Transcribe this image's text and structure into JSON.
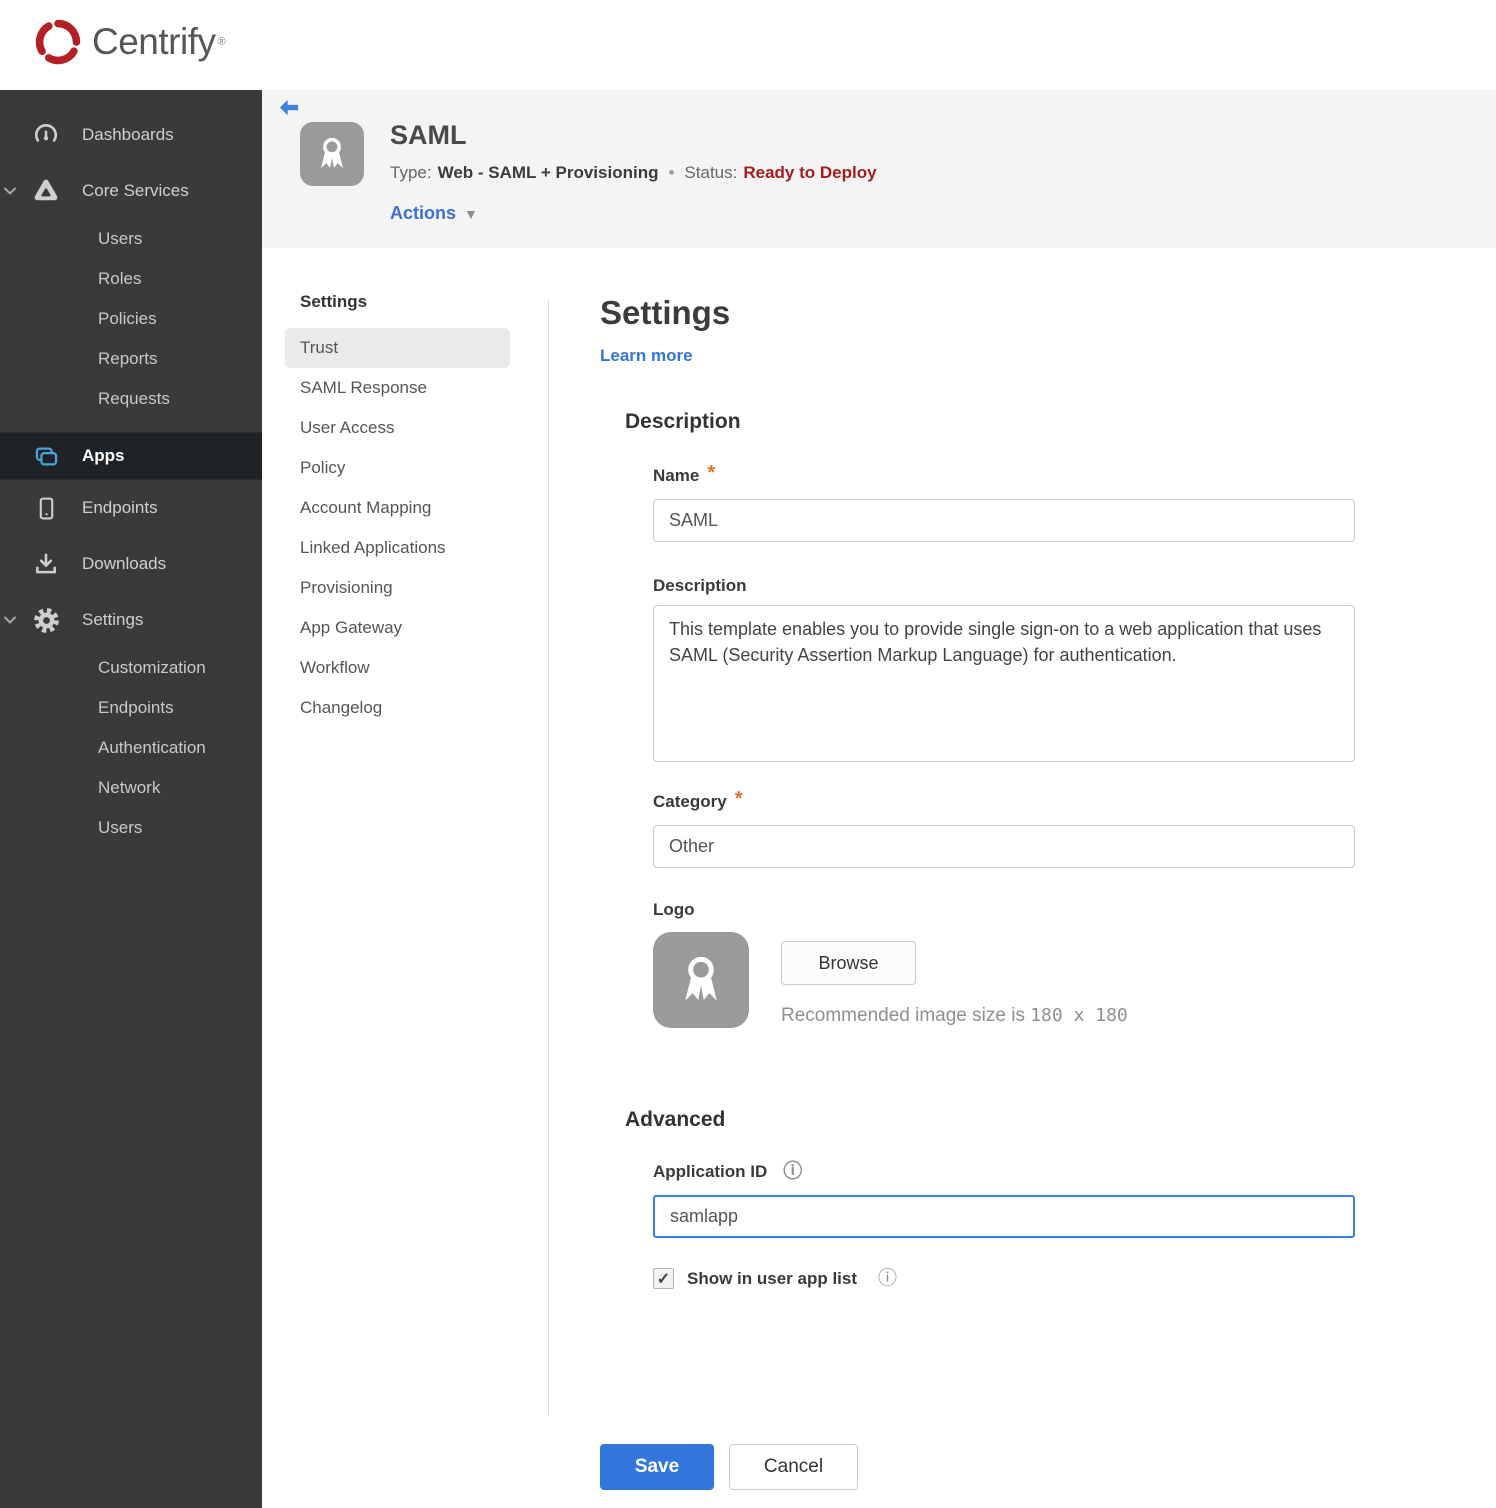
{
  "brand": {
    "name": "Centrify",
    "trademark": "®"
  },
  "colors": {
    "sidebar_bg": "#3a3a3a",
    "sidebar_selected_bg": "#1f2326",
    "accent_blue": "#3377dd",
    "apps_icon_blue": "#4aa3df",
    "status_red": "#a41e1e",
    "required_orange": "#e8702a",
    "header_bg": "#f4f4f5",
    "logo_red": "#b32025"
  },
  "sidebar": {
    "dashboards": "Dashboards",
    "core_services": "Core Services",
    "core_sub": [
      "Users",
      "Roles",
      "Policies",
      "Reports",
      "Requests"
    ],
    "apps": "Apps",
    "endpoints": "Endpoints",
    "downloads": "Downloads",
    "settings": "Settings",
    "settings_sub": [
      "Customization",
      "Endpoints",
      "Authentication",
      "Network",
      "Users"
    ]
  },
  "header": {
    "app_name": "SAML",
    "type_label": "Type:",
    "type_value": "Web - SAML + Provisioning",
    "separator": "•",
    "status_label": "Status:",
    "status_value": "Ready to Deploy",
    "actions_label": "Actions"
  },
  "subnav": {
    "title": "Settings",
    "selected": "Trust",
    "items": [
      "Trust",
      "SAML Response",
      "User Access",
      "Policy",
      "Account Mapping",
      "Linked Applications",
      "Provisioning",
      "App Gateway",
      "Workflow",
      "Changelog"
    ]
  },
  "main": {
    "title": "Settings",
    "learn_more": "Learn more",
    "description_section": "Description",
    "name_label": "Name",
    "name_value": "SAML",
    "description_label": "Description",
    "description_value": "This template enables you to provide single sign-on to a web application that uses SAML (Security Assertion Markup Language) for authentication.",
    "category_label": "Category",
    "category_value": "Other",
    "logo_label": "Logo",
    "browse_label": "Browse",
    "logo_hint_text": "Recommended image size is ",
    "logo_hint_size": "180 x 180",
    "advanced_section": "Advanced",
    "app_id_label": "Application ID",
    "app_id_value": "samlapp",
    "show_in_app_list_label": "Show in user app list",
    "required_marker": "*",
    "save_label": "Save",
    "cancel_label": "Cancel"
  },
  "icons": {
    "info": "ⓘ",
    "dropdown_caret": "▼",
    "check": "✓"
  }
}
